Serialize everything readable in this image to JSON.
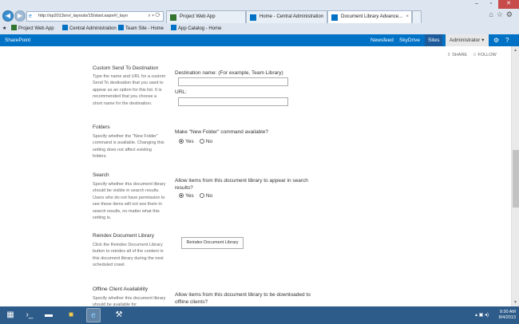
{
  "browser": {
    "address": "http://sp2013srv/_layouts/15/start.aspx#/_layo",
    "tabs": [
      {
        "label": "Project Web App"
      },
      {
        "label": "Home - Central Administration"
      },
      {
        "label": "Document Library Advance..."
      }
    ],
    "favorites": [
      {
        "label": "Project Web App"
      },
      {
        "label": "Central Administration"
      },
      {
        "label": "Team Site - Home"
      },
      {
        "label": "App Catalog - Home"
      }
    ]
  },
  "suitebar": {
    "brand": "SharePoint",
    "links": [
      "Newsfeed",
      "SkyDrive",
      "Sites"
    ],
    "user": "Administrator",
    "share": "SHARE",
    "follow": "FOLLOW"
  },
  "sections": {
    "send_to": {
      "title": "Custom Send To Destination",
      "desc": "Type the name and URL for a custom Send To destination that you want to appear as an option for this list. It is recommended that you choose a short name for the destination.",
      "dest_label": "Destination name: (For example, Team Library)",
      "url_label": "URL:"
    },
    "folders": {
      "title": "Folders",
      "desc": "Specify whether the \"New Folder\" command is available. Changing this setting does not affect existing folders.",
      "question": "Make \"New Folder\" command available?",
      "yes": "Yes",
      "no": "No"
    },
    "search": {
      "title": "Search",
      "desc": "Specify whether this document library should be visible in search results. Users who do not have permission to see these items will not see them in search results, no matter what this setting is.",
      "question": "Allow items from this document library to appear in search results?",
      "yes": "Yes",
      "no": "No"
    },
    "reindex": {
      "title": "Reindex Document Library",
      "desc": "Click the Reindex Document Library button to reindex all of the content in this document library during the next scheduled crawl.",
      "button": "Reindex Document Library"
    },
    "offline": {
      "title": "Offline Client Availability",
      "desc": "Specify whether this document library should be available for",
      "question": "Allow items from this document library to be downloaded to offline clients?"
    }
  },
  "taskbar": {
    "time": "9:30 AM",
    "date": "8/4/2013"
  }
}
